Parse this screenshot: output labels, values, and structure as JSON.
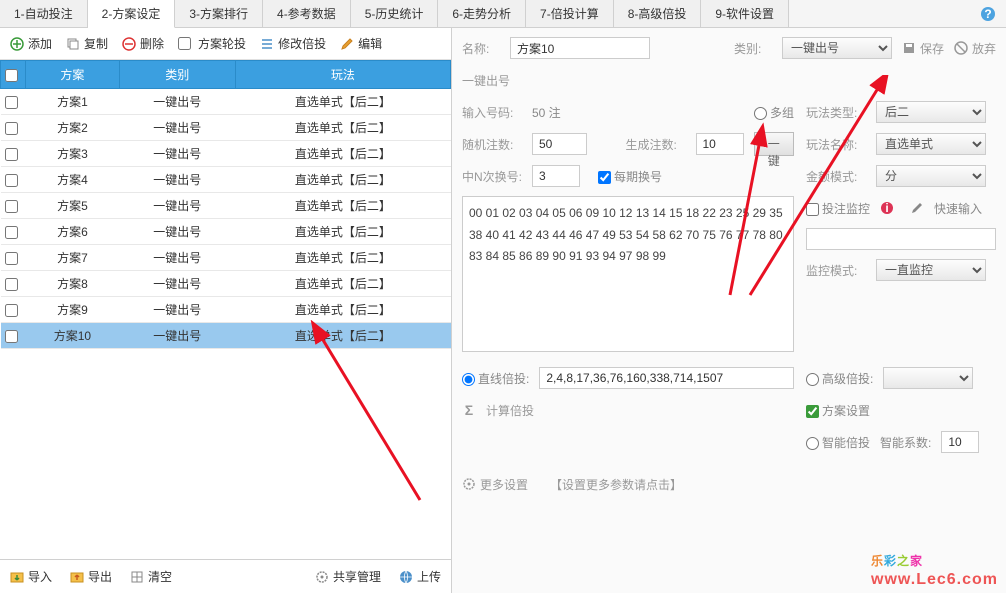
{
  "tabs": [
    "1-自动投注",
    "2-方案设定",
    "3-方案排行",
    "4-参考数据",
    "5-历史统计",
    "6-走势分析",
    "7-倍投计算",
    "8-高级倍投",
    "9-软件设置"
  ],
  "activeTab": 1,
  "toolbar": {
    "add": "添加",
    "copy": "复制",
    "delete": "删除",
    "rotate": "方案轮投",
    "modify": "修改倍投",
    "edit": "编辑"
  },
  "table": {
    "cols": [
      "方案",
      "类别",
      "玩法"
    ],
    "rows": [
      {
        "name": "方案1",
        "cat": "一键出号",
        "play": "直选单式【后二】"
      },
      {
        "name": "方案2",
        "cat": "一键出号",
        "play": "直选单式【后二】"
      },
      {
        "name": "方案3",
        "cat": "一键出号",
        "play": "直选单式【后二】"
      },
      {
        "name": "方案4",
        "cat": "一键出号",
        "play": "直选单式【后二】"
      },
      {
        "name": "方案5",
        "cat": "一键出号",
        "play": "直选单式【后二】"
      },
      {
        "name": "方案6",
        "cat": "一键出号",
        "play": "直选单式【后二】"
      },
      {
        "name": "方案7",
        "cat": "一键出号",
        "play": "直选单式【后二】"
      },
      {
        "name": "方案8",
        "cat": "一键出号",
        "play": "直选单式【后二】"
      },
      {
        "name": "方案9",
        "cat": "一键出号",
        "play": "直选单式【后二】"
      },
      {
        "name": "方案10",
        "cat": "一键出号",
        "play": "直选单式【后二】"
      }
    ],
    "selected": 9
  },
  "bottom": {
    "import": "导入",
    "export": "导出",
    "clear": "清空",
    "share": "共享管理",
    "upload": "上传"
  },
  "right": {
    "name_label": "名称:",
    "name_value": "方案10",
    "cat_label": "类别:",
    "cat_value": "一键出号",
    "save": "保存",
    "discard": "放弃",
    "section": "一键出号",
    "inputnum_label": "输入号码:",
    "inputnum_value": "50 注",
    "multi": "多组",
    "playtype_label": "玩法类型:",
    "playtype_value": "后二",
    "rand_label": "随机注数:",
    "rand_value": "50",
    "gencount_label": "生成注数:",
    "gencount_value": "10",
    "onekey": "一键",
    "playname_label": "玩法名称:",
    "playname_value": "直选单式",
    "interval_label": "中N次换号:",
    "interval_value": "3",
    "each": "每期换号",
    "amount_label": "金额模式:",
    "amount_value": "分",
    "monitor": "投注监控",
    "quickin": "快速输入",
    "monmode_label": "监控模式:",
    "monmode_value": "一直监控",
    "numbers": "00 01 02 03 04 05 06 09 10 12 13 14 15 18 22 23 25 29 35 38 40 41 42 43 44 46 47 49 53 54 58 62 70 75 76 77 78 80 83 84 85 86 89 90 91 93 94 97 98 99",
    "line_bet": "直线倍投:",
    "line_value": "2,4,8,17,36,76,160,338,714,1507",
    "calc_bet": "计算倍投",
    "adv_bet": "高级倍投:",
    "plan_set": "方案设置",
    "smart_bet": "智能倍投",
    "smart_factor": "智能系数:",
    "smart_value": "10",
    "more": "更多设置",
    "more_hint": "【设置更多参数请点击】"
  },
  "watermark": {
    "brand": "乐彩之家",
    "url": "www.Lec6.com"
  }
}
